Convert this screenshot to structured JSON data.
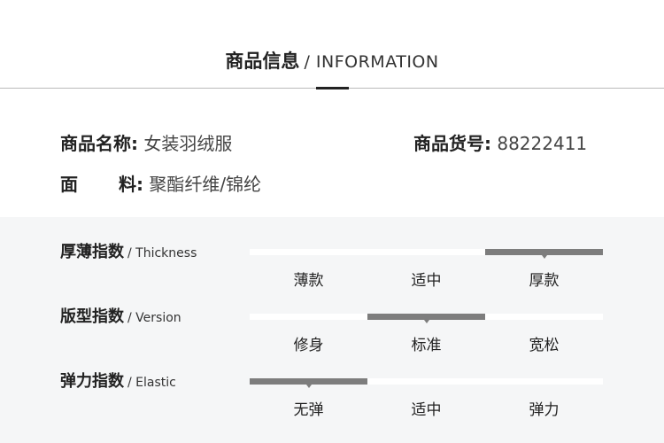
{
  "header": {
    "title_cn": "商品信息",
    "title_en": "/ INFORMATION"
  },
  "info": {
    "name_label": "商品名称:",
    "name_value": "女装羽绒服",
    "sku_label": "商品货号:",
    "sku_value": "88222411",
    "material_label_1": "面",
    "material_label_2": "料:",
    "material_value": "聚酯纤维/锦纶"
  },
  "metrics": [
    {
      "label_cn": "厚薄指数",
      "label_en": "/ Thickness",
      "options": [
        "薄款",
        "适中",
        "厚款"
      ],
      "selected_index": 2
    },
    {
      "label_cn": "版型指数",
      "label_en": "/ Version",
      "options": [
        "修身",
        "标准",
        "宽松"
      ],
      "selected_index": 1
    },
    {
      "label_cn": "弹力指数",
      "label_en": "/ Elastic",
      "options": [
        "无弹",
        "适中",
        "弹力"
      ],
      "selected_index": 0
    }
  ],
  "colors": {
    "indicator": "#7d7d7d",
    "panel_bg": "#f5f6f7",
    "track": "#ffffff",
    "accent_underline": "#222222"
  }
}
